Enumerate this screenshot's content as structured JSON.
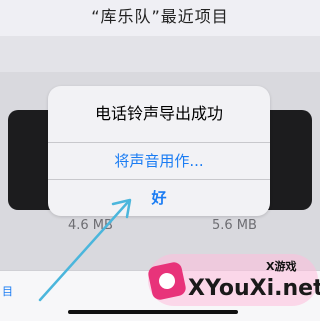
{
  "nav": {
    "title": "“库乐队”最近项目"
  },
  "projects": [
    {
      "size": "4.6 MB"
    },
    {
      "size": "5.6 MB"
    }
  ],
  "alert": {
    "title": "电话铃声导出成功",
    "actions": [
      {
        "label": "将声音用作..."
      },
      {
        "label": "好"
      }
    ]
  },
  "bottom": {
    "partial_label": "目"
  },
  "watermark": {
    "small": "X游戏",
    "big": "XYouXi.net"
  },
  "colors": {
    "accent": "#1a7cf3",
    "arrow": "#4bb6dc",
    "brand": "#e8337a"
  }
}
